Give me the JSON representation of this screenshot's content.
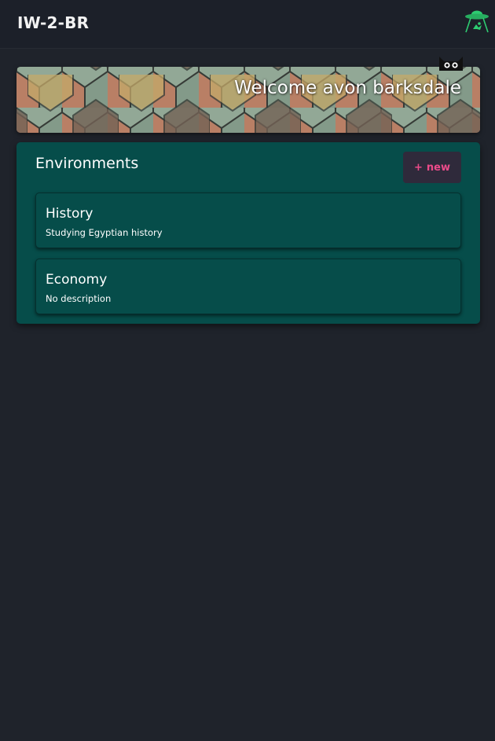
{
  "header": {
    "title": "IW-2-BR",
    "logo_icon": "ufo-abduction-icon"
  },
  "banner": {
    "welcome_text": "Welcome avon barksdale",
    "background": "tiled-shingles-pattern",
    "mascot_icon": "cat-mascot-icon"
  },
  "environments": {
    "title": "Environments",
    "new_button": {
      "icon": "+",
      "label": "new"
    },
    "items": [
      {
        "name": "History",
        "description": "Studying Egyptian history"
      },
      {
        "name": "Economy",
        "description": "No description"
      }
    ]
  },
  "colors": {
    "page_background": "#1f232b",
    "header_background": "#1c2029",
    "panel_background": "#064d4a",
    "accent_pink": "#ec4b8a",
    "logo_green": "#2ecc71"
  }
}
